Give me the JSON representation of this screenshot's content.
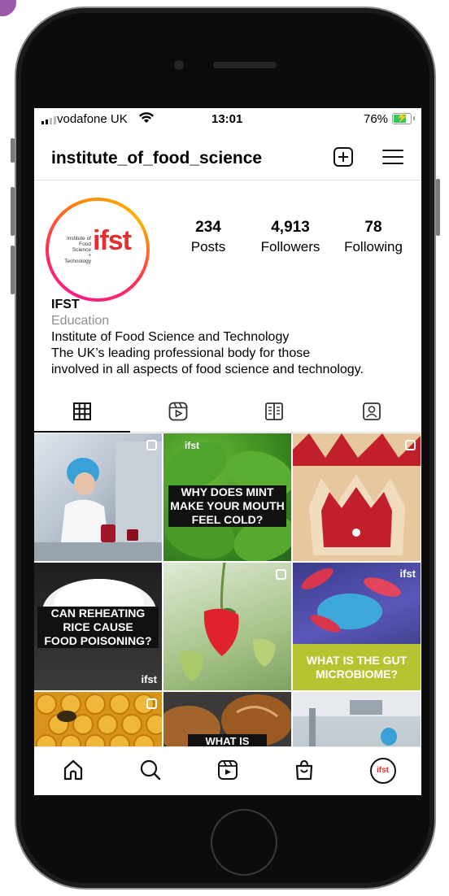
{
  "status_bar": {
    "carrier": "vodafone UK",
    "time": "13:01",
    "battery_percent": "76%"
  },
  "header": {
    "username": "institute_of_food_science",
    "new_post_icon": "plus-square-icon",
    "menu_icon": "hamburger-menu-icon"
  },
  "profile": {
    "avatar_logo": {
      "small_lines": [
        "Institute of",
        "Food Science",
        "+ Technology"
      ],
      "big": "ifst"
    },
    "stats": [
      {
        "value": "234",
        "label": "Posts"
      },
      {
        "value": "4,913",
        "label": "Followers"
      },
      {
        "value": "78",
        "label": "Following"
      }
    ],
    "name": "IFST",
    "category": "Education",
    "bio_line1": "Institute of Food Science and Technology",
    "bio_line2": "The UK’s leading professional body for those",
    "bio_line3": "involved in all aspects of food science and technology."
  },
  "tabs": [
    {
      "name": "grid",
      "icon": "grid-icon",
      "active": true
    },
    {
      "name": "reels",
      "icon": "reels-icon",
      "active": false
    },
    {
      "name": "guides",
      "icon": "guides-icon",
      "active": false
    },
    {
      "name": "tagged",
      "icon": "tagged-icon",
      "active": false
    }
  ],
  "posts": {
    "p1": {
      "kind": "photo"
    },
    "p2": {
      "brand": "ifst",
      "caption_lines": [
        "WHY DOES MINT",
        "MAKE YOUR MOUTH",
        "FEEL COLD?"
      ]
    },
    "p3": {
      "kind": "photo"
    },
    "p4": {
      "caption_lines": [
        "CAN REHEATING",
        "RICE CAUSE",
        "FOOD POISONING?"
      ],
      "brand": "ifst"
    },
    "p5": {
      "kind": "photo"
    },
    "p6": {
      "brand": "ifst",
      "caption_lines": [
        "WHAT IS THE GUT",
        "MICROBIOME?"
      ]
    },
    "p7": {
      "kind": "photo"
    },
    "p8": {
      "caption": "WHAT IS"
    },
    "p9": {
      "kind": "photo"
    }
  },
  "bottom_nav": {
    "home_icon": "home-icon",
    "search_icon": "search-icon",
    "reels_icon": "reels-icon",
    "shop_icon": "shop-bag-icon",
    "profile_avatar_text": "ifst"
  },
  "colors": {
    "brand_red": "#e62e2e",
    "ring_pink": "#ff1a8c",
    "ring_orange": "#ff8c00",
    "microbiome_green": "#b5c430"
  }
}
